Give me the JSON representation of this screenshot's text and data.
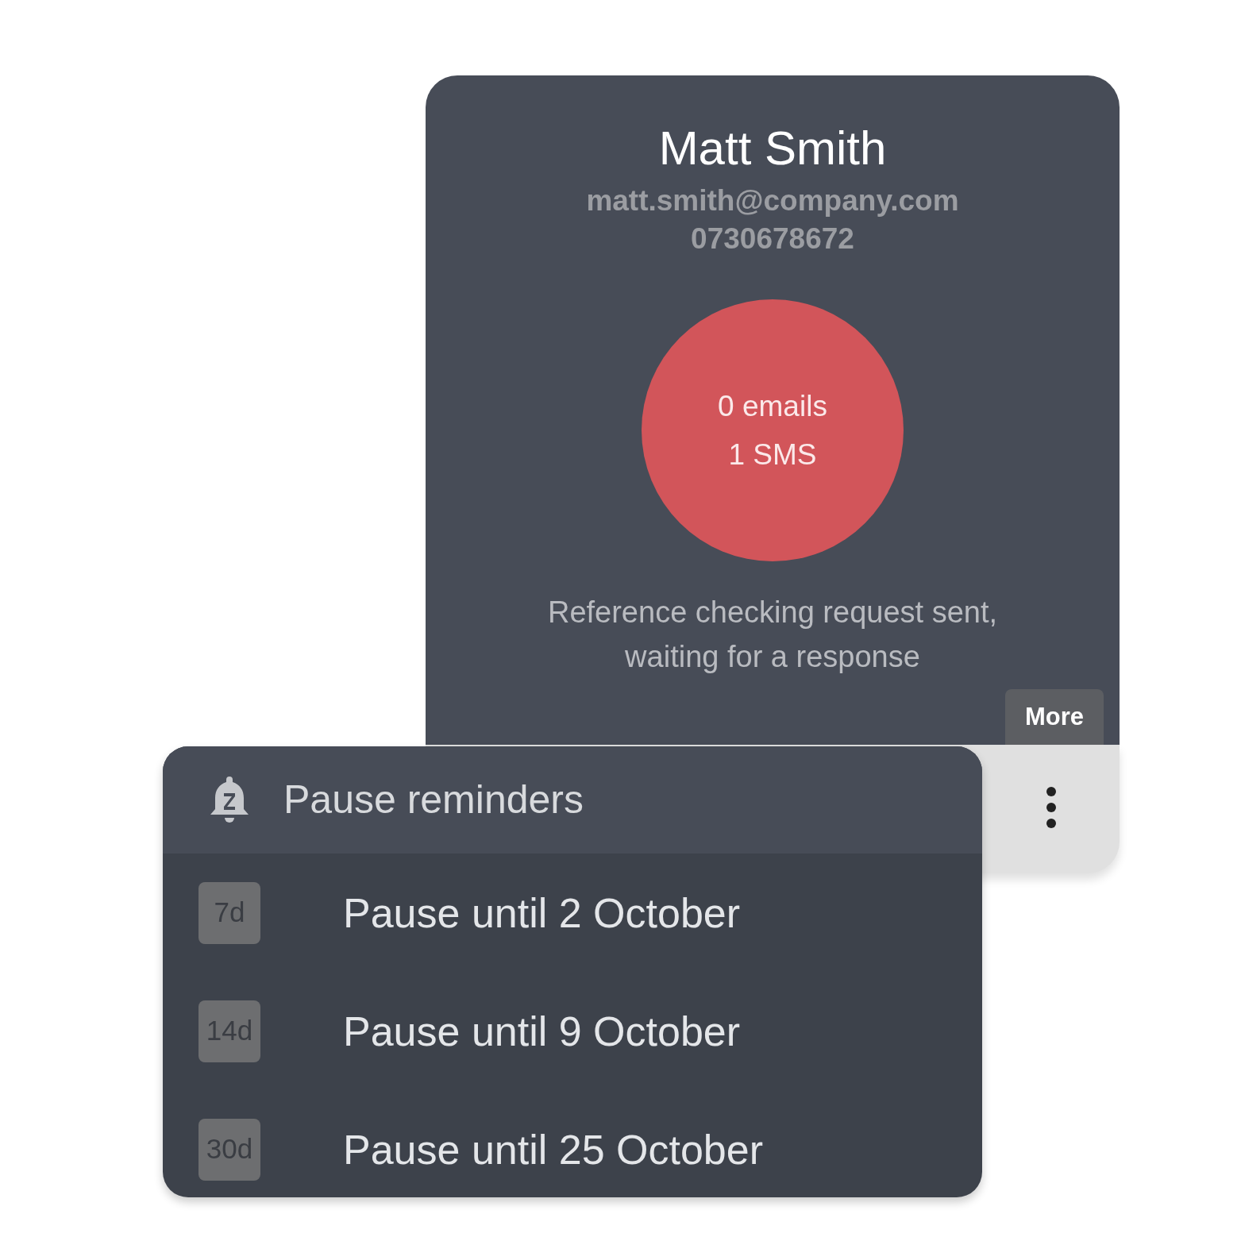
{
  "contact": {
    "name": "Matt Smith",
    "email": "matt.smith@company.com",
    "phone": "0730678672"
  },
  "stats": [
    "0 emails",
    "1 SMS"
  ],
  "status_text": "Reference checking request sent, waiting for a response",
  "more_button": "More",
  "menu": {
    "title": "Pause reminders",
    "items": [
      {
        "badge": "7d",
        "label": "Pause until 2 October"
      },
      {
        "badge": "14d",
        "label": "Pause until 9 October"
      },
      {
        "badge": "30d",
        "label": "Pause until 25 October"
      }
    ]
  }
}
